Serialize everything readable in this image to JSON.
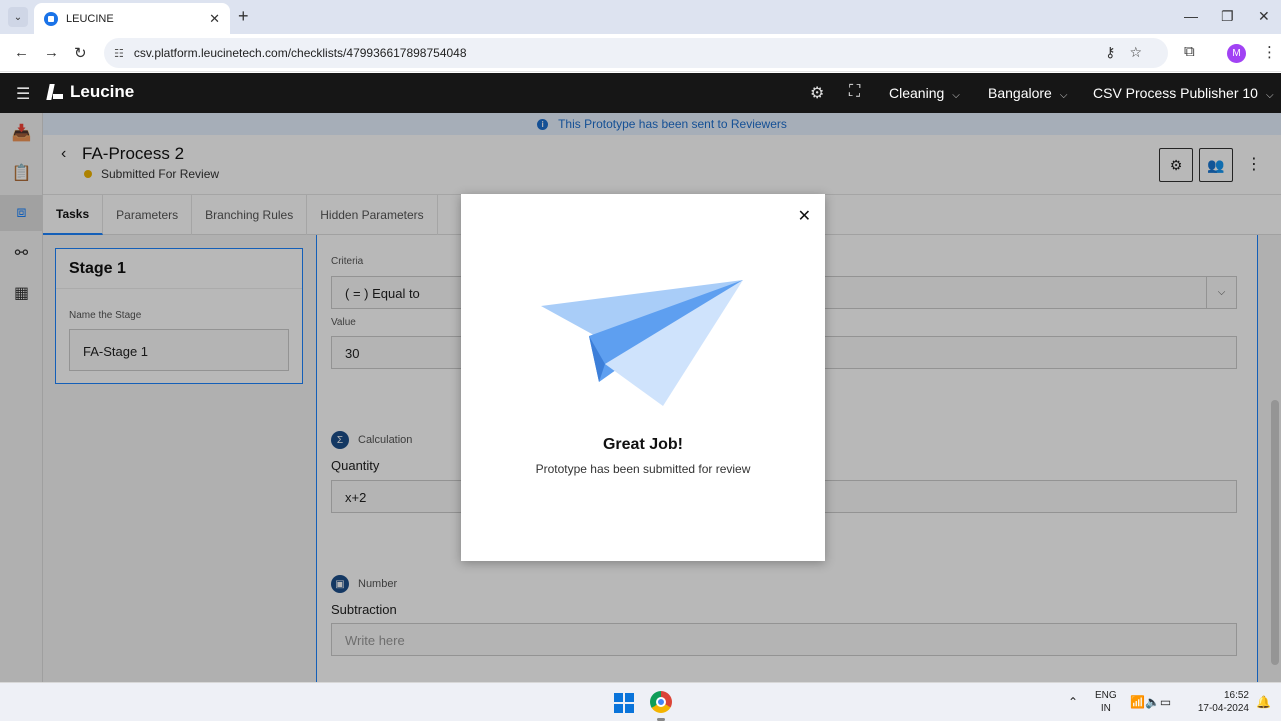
{
  "browser": {
    "tab_title": "LEUCINE",
    "url": "csv.platform.leucinetech.com/checklists/479936617898754048",
    "profile_initial": "M"
  },
  "appbar": {
    "brand": "Leucine",
    "facility_select": "Cleaning",
    "location_select": "Bangalore",
    "user_select": "CSV Process Publisher 10"
  },
  "banner": {
    "text": "This Prototype has been sent to Reviewers"
  },
  "page": {
    "title": "FA-Process 2",
    "status": "Submitted For Review"
  },
  "tabs": [
    "Tasks",
    "Parameters",
    "Branching Rules",
    "Hidden Parameters"
  ],
  "stage": {
    "title": "Stage 1",
    "name_label": "Name the Stage",
    "name_value": "FA-Stage 1"
  },
  "task": {
    "criteria_label": "Criteria",
    "criteria_value": "( = ) Equal to",
    "value_label": "Value",
    "value_value": "30",
    "calc_type": "Calculation",
    "calc_name": "Quantity",
    "calc_value": "x+2",
    "num_type": "Number",
    "num_name": "Subtraction",
    "num_placeholder": "Write here"
  },
  "modal": {
    "title": "Great Job!",
    "message": "Prototype has been submitted for review"
  },
  "taskbar": {
    "lang_top": "ENG",
    "lang_bottom": "IN",
    "time": "16:52",
    "date": "17-04-2024"
  }
}
